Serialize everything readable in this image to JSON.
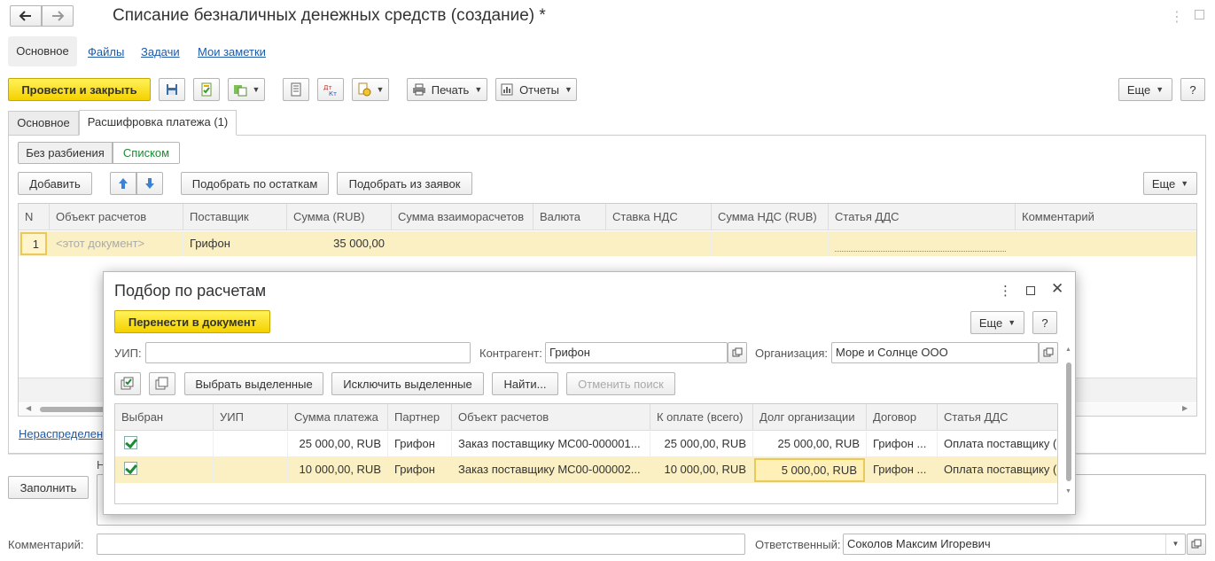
{
  "window": {
    "title": "Списание безналичных денежных средств (создание) *"
  },
  "nav_tabs": [
    "Основное",
    "Файлы",
    "Задачи",
    "Мои заметки"
  ],
  "toolbar": {
    "post_close": "Провести и закрыть",
    "print": "Печать",
    "reports": "Отчеты",
    "more": "Еще",
    "help": "?"
  },
  "form_tabs": [
    "Основное",
    "Расшифровка платежа (1)"
  ],
  "mode": {
    "split_none": "Без разбиения",
    "list": "Списком"
  },
  "table_toolbar": {
    "add": "Добавить",
    "pick_balance": "Подобрать по остаткам",
    "pick_requests": "Подобрать из заявок",
    "more": "Еще"
  },
  "main_table": {
    "columns": [
      "N",
      "Объект расчетов",
      "Поставщик",
      "Сумма (RUB)",
      "Сумма взаиморасчетов",
      "Валюта",
      "Ставка НДС",
      "Сумма НДС (RUB)",
      "Статья ДДС",
      "Комментарий"
    ],
    "rows": [
      {
        "n": "1",
        "object": "<этот документ>",
        "supplier": "Грифон",
        "sum": "35 000,00"
      }
    ]
  },
  "unallocated_link": "Нераспределен",
  "bottom": {
    "fill": "Заполнить",
    "n_label": "Н",
    "comment_label": "Комментарий:",
    "comment_value": "",
    "responsible_label": "Ответственный:",
    "responsible_value": "Соколов Максим Игоревич"
  },
  "dialog": {
    "title": "Подбор по расчетам",
    "transfer": "Перенести в документ",
    "more": "Еще",
    "help": "?",
    "uip_label": "УИП:",
    "uip_value": "",
    "counterparty_label": "Контрагент:",
    "counterparty_value": "Грифон",
    "org_label": "Организация:",
    "org_value": "Море и Солнце ООО",
    "select_selected": "Выбрать выделенные",
    "exclude_selected": "Исключить выделенные",
    "find": "Найти...",
    "cancel_search": "Отменить поиск",
    "columns": [
      "Выбран",
      "УИП",
      "Сумма платежа",
      "Партнер",
      "Объект расчетов",
      "К оплате (всего)",
      "Долг организации",
      "Договор",
      "Статья ДДС"
    ],
    "rows": [
      {
        "selected": true,
        "uip": "",
        "payment": "25 000,00, RUB",
        "partner": "Грифон",
        "object": "Заказ поставщику МС00-000001...",
        "to_pay": "25 000,00, RUB",
        "debt": "25 000,00, RUB",
        "contract": "Грифон ...",
        "dds": "Оплата поставщику (:"
      },
      {
        "selected": true,
        "uip": "",
        "payment": "10 000,00, RUB",
        "partner": "Грифон",
        "object": "Заказ поставщику МС00-000002...",
        "to_pay": "10 000,00, RUB",
        "debt": "5 000,00, RUB",
        "contract": "Грифон ...",
        "dds": "Оплата поставщику (:"
      }
    ]
  },
  "colors": {
    "accent_yellow": "#f4d100",
    "row_highlight": "#fbf0c4",
    "link": "#1e5aa8",
    "list_green": "#1e8a34"
  }
}
